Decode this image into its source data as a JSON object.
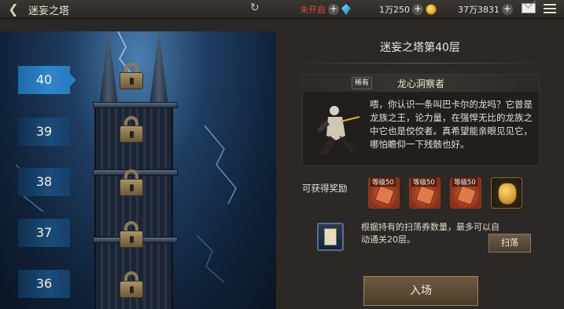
{
  "header": {
    "title": "迷妄之塔",
    "status_text": "未开启",
    "currency_1": "1万250",
    "currency_2": "37万3831"
  },
  "tower": {
    "floors": [
      {
        "label": "40",
        "active": true
      },
      {
        "label": "39",
        "active": false
      },
      {
        "label": "38",
        "active": false
      },
      {
        "label": "37",
        "active": false
      },
      {
        "label": "36",
        "active": false
      }
    ]
  },
  "detail": {
    "floor_title": "迷妄之塔第40层",
    "rarity": "稀有",
    "boss_name": "龙心洞察者",
    "description": "喂，你认识一条叫巴卡尔的龙吗？它曾是龙族之王，论力量，在强悍无比的龙族之中它也是佼佼者。真希望能亲眼见见它，哪怕瞻仰一下残骸也好。",
    "reward_label": "可获得奖励",
    "rewards": [
      {
        "level": "等级50"
      },
      {
        "level": "等级50"
      },
      {
        "level": "等级50"
      },
      {
        "level": ""
      }
    ],
    "sweep_desc": "根据持有的扫荡券数量，最多可以自动通关20层。",
    "sweep_button": "扫荡",
    "enter_button": "入场"
  },
  "colors": {
    "accent_blue": "#2f86cc",
    "button_brown": "#5a4b38"
  }
}
